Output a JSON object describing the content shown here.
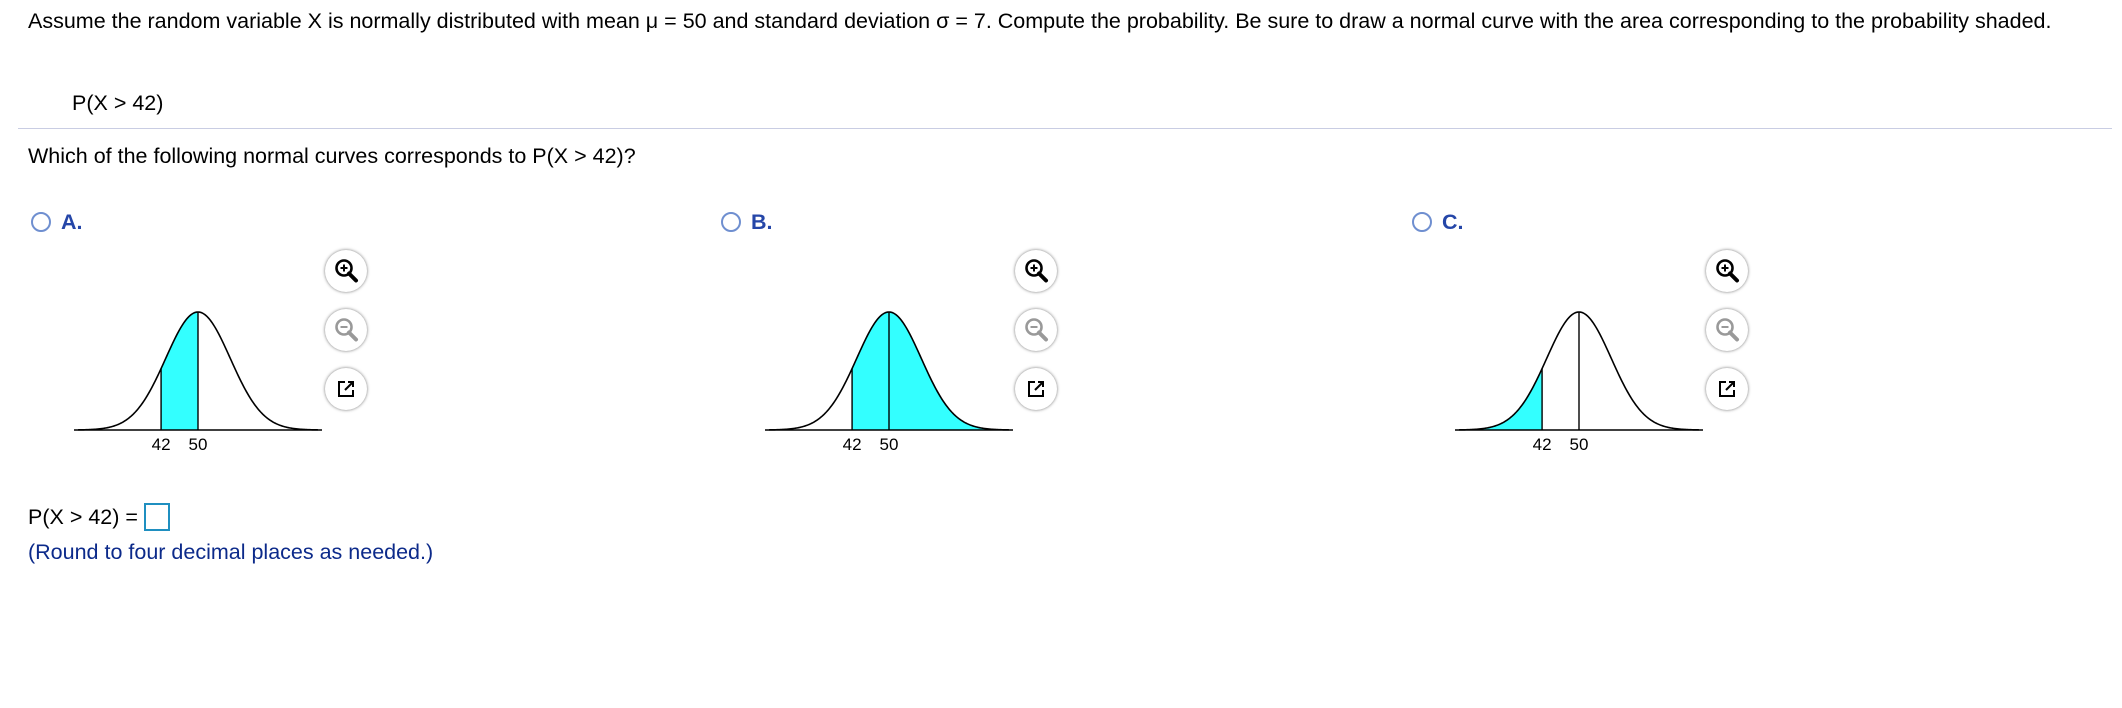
{
  "prompt": "Assume the random variable X is normally distributed with mean μ = 50 and standard deviation σ = 7. Compute the probability. Be sure to draw a normal curve with the area corresponding to the probability shaded.",
  "given": "P(X > 42)",
  "question": "Which of the following normal curves corresponds to P(X > 42)?",
  "colors": {
    "shade": "#33ffff",
    "option_label": "#2546a8",
    "note": "#0c2a8a",
    "radio": "#6f8fd0"
  },
  "options": [
    {
      "label": "A.",
      "shade": "between 42 and 50",
      "ticks": [
        "42",
        "50"
      ]
    },
    {
      "label": "B.",
      "shade": "greater than 42",
      "ticks": [
        "42",
        "50"
      ]
    },
    {
      "label": "C.",
      "shade": "less than 42",
      "ticks": [
        "42",
        "50"
      ]
    }
  ],
  "tools": {
    "zoom_in": "zoom-in-icon",
    "zoom_out": "zoom-out-icon",
    "popout": "popout-icon"
  },
  "answer": {
    "label": "P(X > 42) =",
    "value": ""
  },
  "note": "(Round to four decimal places as needed.)"
}
